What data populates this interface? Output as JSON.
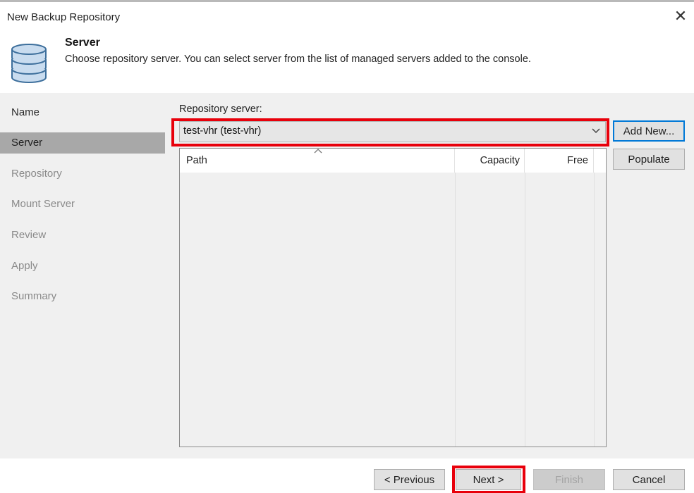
{
  "window": {
    "title": "New Backup Repository",
    "close_glyph": "✕"
  },
  "header": {
    "title": "Server",
    "subtitle": "Choose repository server. You can select server from the list of managed servers added to the console.",
    "icon": "database-icon"
  },
  "nav": {
    "items": [
      {
        "label": "Name",
        "state": "done"
      },
      {
        "label": "Server",
        "state": "active"
      },
      {
        "label": "Repository",
        "state": "pending"
      },
      {
        "label": "Mount Server",
        "state": "pending"
      },
      {
        "label": "Review",
        "state": "pending"
      },
      {
        "label": "Apply",
        "state": "pending"
      },
      {
        "label": "Summary",
        "state": "pending"
      }
    ]
  },
  "server": {
    "label": "Repository server:",
    "selected": "test-vhr (test-vhr)",
    "add_new": "Add New...",
    "populate": "Populate"
  },
  "table": {
    "columns": [
      "Path",
      "Capacity",
      "Free"
    ],
    "rows": []
  },
  "footer": {
    "previous": "< Previous",
    "next": "Next >",
    "finish": "Finish",
    "cancel": "Cancel"
  },
  "colors": {
    "highlight": "#e8000b",
    "active_nav": "#a8a8a8",
    "panel": "#f0f0f0",
    "focus": "#0078d7"
  }
}
